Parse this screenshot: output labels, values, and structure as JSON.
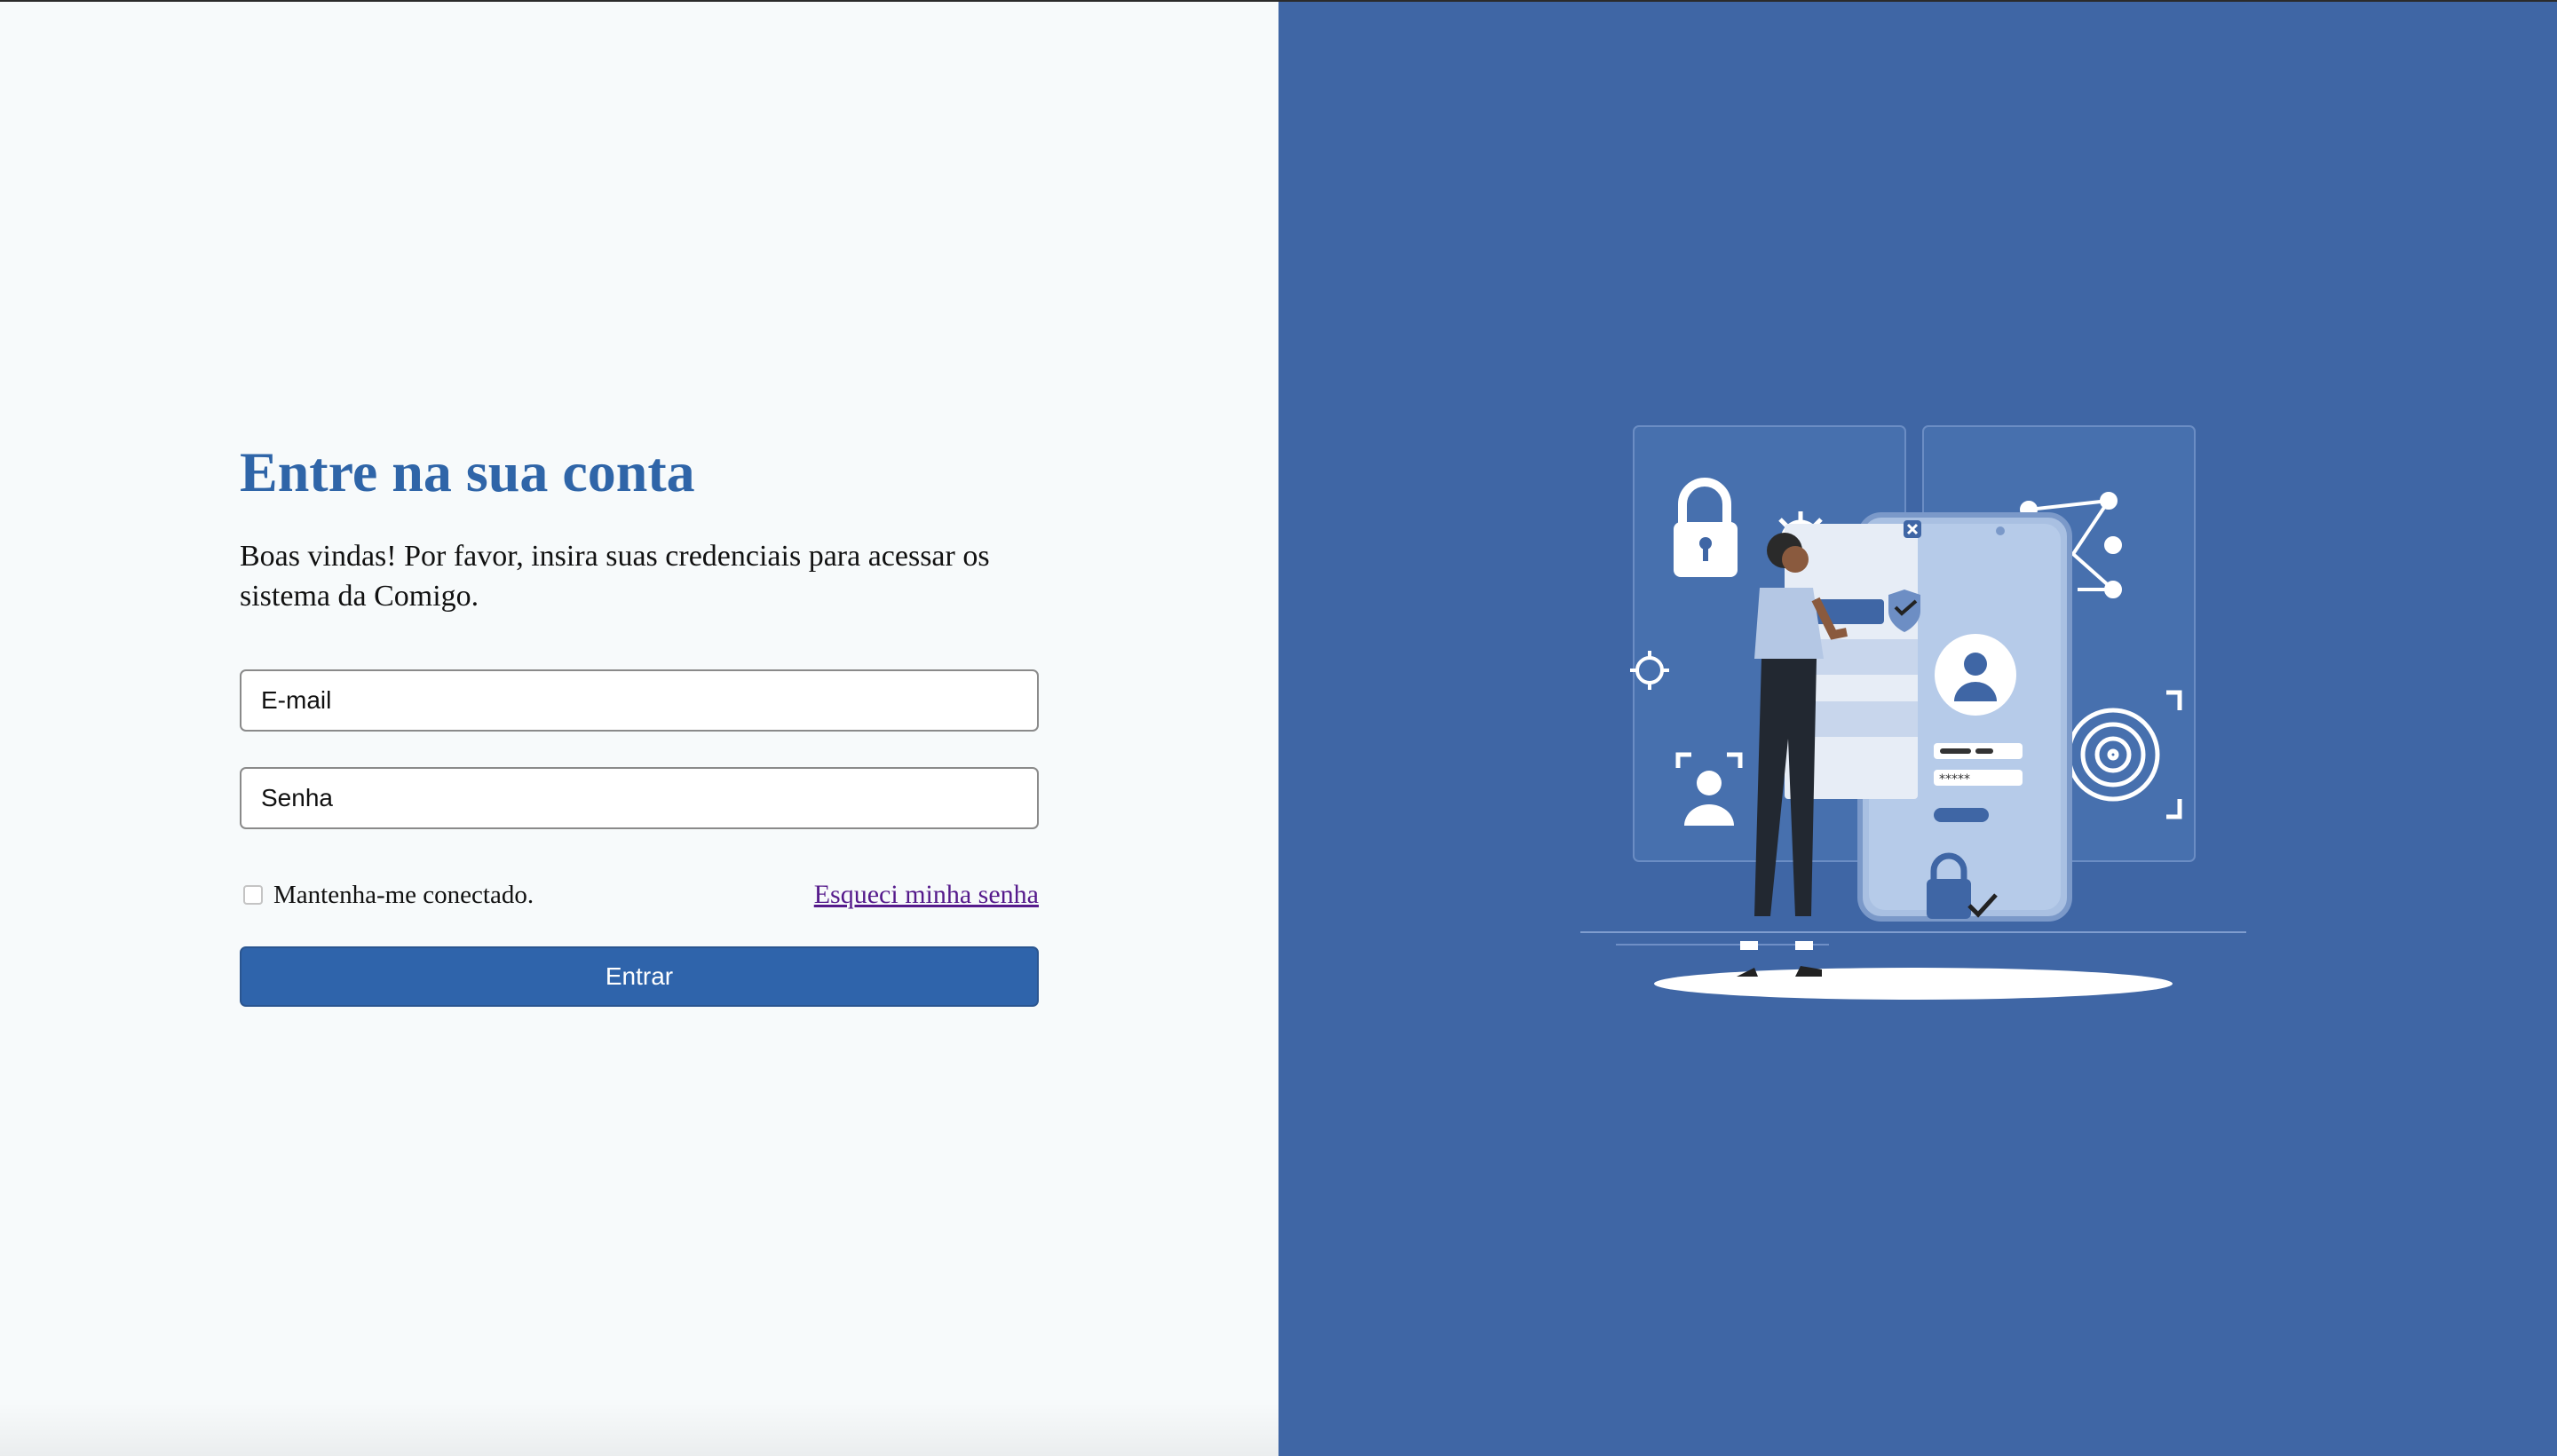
{
  "login": {
    "title": "Entre na sua conta",
    "subtitle": "Boas vindas! Por favor, insira suas credenciais para acessar os sistema da Comigo.",
    "email_placeholder": "E-mail",
    "password_placeholder": "Senha",
    "remember_label": "Mantenha-me conectado.",
    "forgot_label": "Esqueci minha senha",
    "submit_label": "Entrar"
  },
  "illustration": {
    "password_mask": "*****"
  },
  "colors": {
    "accent": "#2f65a8",
    "panel_blue": "#3f66a5",
    "background": "#f7fafb",
    "visited_link": "#551a8b"
  }
}
